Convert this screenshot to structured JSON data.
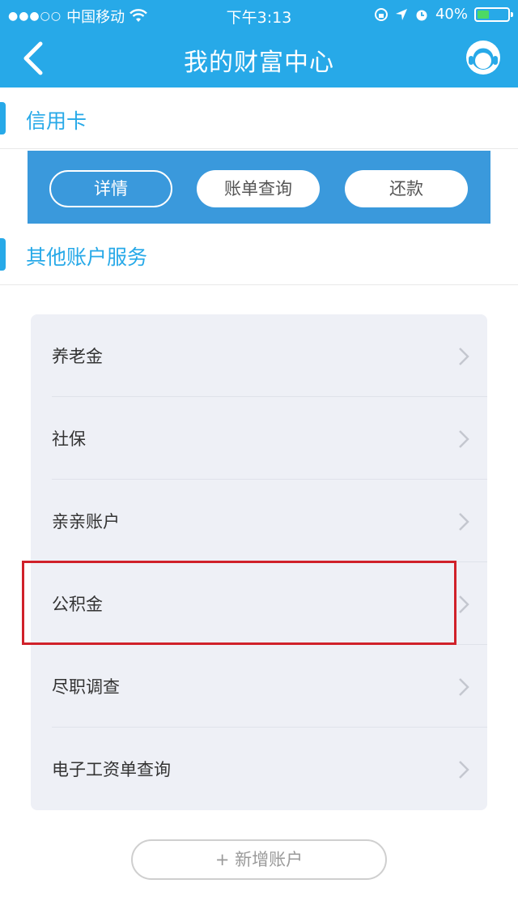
{
  "status_bar": {
    "carrier": "中国移动",
    "time": "下午3:13",
    "battery": "40%",
    "battery_level": 0.4
  },
  "nav": {
    "title": "我的财富中心",
    "back_icon": "chevron-left-icon",
    "service_icon": "customer-service-icon"
  },
  "credit_card": {
    "section_label": "信用卡",
    "buttons": [
      "详情",
      "账单查询",
      "还款"
    ]
  },
  "other_services": {
    "section_label": "其他账户服务",
    "items": [
      "养老金",
      "社保",
      "亲亲账户",
      "公积金",
      "尽职调查",
      "电子工资单查询"
    ]
  },
  "add_account_label": "+ 新增账户",
  "colors": {
    "accent": "#27a9e8",
    "card_strip": "#3a99dc",
    "highlight": "#d0212a",
    "list_bg": "#eef0f6"
  }
}
